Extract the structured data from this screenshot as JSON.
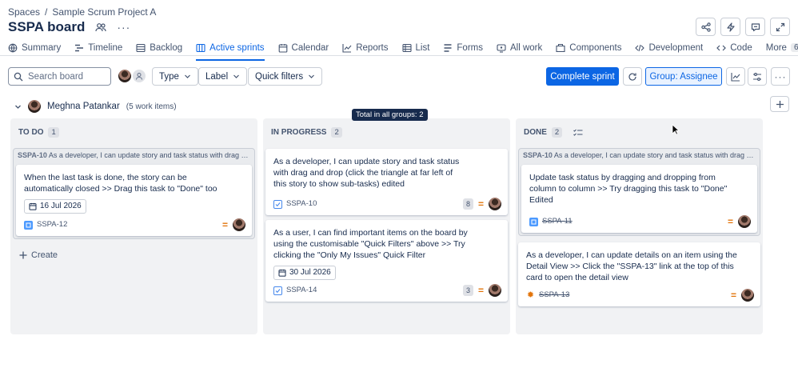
{
  "breadcrumb": {
    "spaces": "Spaces",
    "separator": "/",
    "project": "Sample Scrum Project A"
  },
  "page": {
    "title": "SSPA board"
  },
  "tabs": [
    {
      "label": "Summary",
      "icon": "globe-icon"
    },
    {
      "label": "Timeline",
      "icon": "timeline-icon"
    },
    {
      "label": "Backlog",
      "icon": "backlog-icon"
    },
    {
      "label": "Active sprints",
      "icon": "board-icon",
      "active": true
    },
    {
      "label": "Calendar",
      "icon": "calendar-icon"
    },
    {
      "label": "Reports",
      "icon": "chart-icon"
    },
    {
      "label": "List",
      "icon": "list-icon"
    },
    {
      "label": "Forms",
      "icon": "forms-icon"
    },
    {
      "label": "All work",
      "icon": "all-work-icon"
    },
    {
      "label": "Components",
      "icon": "components-icon"
    },
    {
      "label": "Development",
      "icon": "code-brackets-icon"
    },
    {
      "label": "Code",
      "icon": "code-icon"
    }
  ],
  "tabs_more": {
    "label": "More",
    "count": "6"
  },
  "toolbar": {
    "search_placeholder": "Search board",
    "type_label": "Type",
    "label_label": "Label",
    "quick_filters_label": "Quick filters",
    "complete_sprint": "Complete sprint",
    "group_by": "Group: Assignee"
  },
  "group": {
    "assignee": "Meghna Patankar",
    "count": "(5 work items)"
  },
  "tooltip": "Total in all groups: 2",
  "columns": [
    {
      "title": "TO DO",
      "count": "1"
    },
    {
      "title": "IN PROGRESS",
      "count": "2"
    },
    {
      "title": "DONE",
      "count": "2"
    }
  ],
  "parents": {
    "todo": {
      "key": "SSPA-10",
      "summary": "As a developer, I can update story and task status with drag a..."
    },
    "done": {
      "key": "SSPA-10",
      "summary": "As a developer, I can update story and task status with drag and..."
    }
  },
  "cards": {
    "todo1": {
      "text": "When the last task is done, the story can be\nautomatically closed >> Drag this task to \"Done\" too",
      "date": "16 Jul 2026",
      "key": "SSPA-12",
      "type": "story"
    },
    "prog1": {
      "text": "As a developer, I can update story and task status\nwith drag and drop (click the triangle at far left of\nthis story to show sub-tasks) edited",
      "key": "SSPA-10",
      "points": "8",
      "type": "task"
    },
    "prog2": {
      "text": "As a user, I can find important items on the board by\nusing the customisable \"Quick Filters\" above >> Try\nclicking the \"Only My Issues\" Quick Filter",
      "date": "30 Jul 2026",
      "key": "SSPA-14",
      "points": "3",
      "type": "task"
    },
    "done1": {
      "text": "Update task status by dragging and dropping from\ncolumn to column >> Try dragging this task to \"Done\"\nEdited",
      "key": "SSPA-11",
      "type": "story"
    },
    "done2": {
      "text": "As a developer, I can update details on an item using the\nDetail View >> Click the \"SSPA-13\" link at the top of this\ncard to open the detail view",
      "key": "SSPA-13",
      "type": "bug"
    }
  },
  "create_label": "Create",
  "colors": {
    "primary": "#0c66e4",
    "column_bg": "#f1f2f4",
    "priority": "#e2740b"
  }
}
